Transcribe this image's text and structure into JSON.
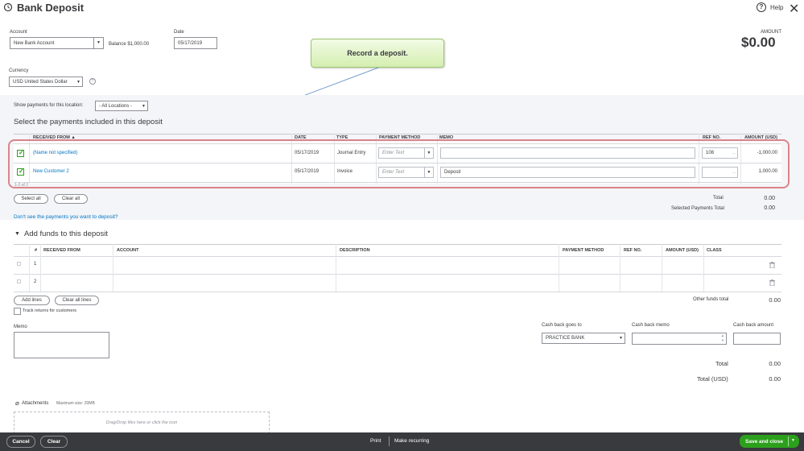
{
  "header": {
    "title": "Bank Deposit",
    "help_label": "Help"
  },
  "account": {
    "label": "Account",
    "value": "New Bank Account",
    "balance": "Balance $1,000.00"
  },
  "date": {
    "label": "Date",
    "value": "05/17/2019"
  },
  "amount": {
    "label": "AMOUNT",
    "value": "$0.00"
  },
  "currency": {
    "label": "Currency",
    "value": "USD United States Dollar"
  },
  "callout": {
    "text": "Record a deposit."
  },
  "location": {
    "label": "Show payments for this location:",
    "value": "- All Locations -"
  },
  "payments": {
    "section_title": "Select the payments included in this deposit",
    "columns": {
      "received_from": "RECEIVED FROM ▲",
      "date": "DATE",
      "type": "TYPE",
      "payment_method": "PAYMENT METHOD",
      "memo": "MEMO",
      "ref_no": "REF NO.",
      "amount": "AMOUNT (USD)"
    },
    "rows": [
      {
        "received_from": "(Name not specified)",
        "date": "05/17/2019",
        "type": "Journal Entry",
        "method_placeholder": "Enter Text",
        "memo": "",
        "ref_no": "108",
        "amount": "-1,000.00"
      },
      {
        "received_from": "New Customer 2",
        "date": "05/17/2019",
        "type": "Invoice",
        "method_placeholder": "Enter Text",
        "memo": "Deposit",
        "ref_no": "",
        "amount": "1,000.00"
      }
    ],
    "pager": "1-2 of 2",
    "select_all": "Select all",
    "clear_all": "Clear all",
    "total_label": "Total",
    "total_value": "0.00",
    "selected_total_label": "Selected Payments Total",
    "selected_total_value": "0.00",
    "missing_link": "Don't see the payments you want to deposit?"
  },
  "funds": {
    "section_title": "Add funds to this deposit",
    "columns": {
      "num": "#",
      "received_from": "RECEIVED FROM",
      "account": "ACCOUNT",
      "description": "DESCRIPTION",
      "payment_method": "PAYMENT METHOD",
      "ref_no": "REF NO.",
      "amount": "AMOUNT (USD)",
      "class": "CLASS"
    },
    "rows": [
      {
        "num": "1"
      },
      {
        "num": "2"
      }
    ],
    "add_lines": "Add lines",
    "clear_all_lines": "Clear all lines",
    "other_total_label": "Other funds total",
    "other_total_value": "0.00",
    "track_returns": "Track returns for customers"
  },
  "memo": {
    "label": "Memo"
  },
  "cashback": {
    "goes_to_label": "Cash back goes to",
    "goes_to_value": "PRACTICE BANK",
    "memo_label": "Cash back memo",
    "amount_label": "Cash back amount"
  },
  "totals": {
    "total_label": "Total",
    "total_value": "0.00",
    "total_usd_label": "Total (USD)",
    "total_usd_value": "0.00"
  },
  "attachments": {
    "label": "Attachments",
    "max_size": "Maximum size: 20MB",
    "drop_hint": "Drag/Drop files here or click the icon"
  },
  "footer": {
    "cancel": "Cancel",
    "clear": "Clear",
    "print": "Print",
    "make_recurring": "Make recurring",
    "save_close": "Save and close"
  },
  "colors": {
    "accent_green": "#2ca01c",
    "link_blue": "#0077c5",
    "footer_bg": "#393a3d",
    "callout_bg": "#e2f5c4"
  }
}
